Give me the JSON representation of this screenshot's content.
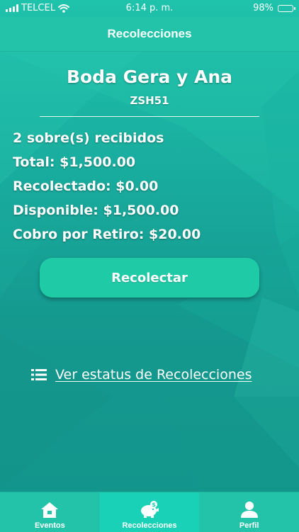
{
  "status_bar": {
    "carrier": "TELCEL",
    "time": "6:14 p. m.",
    "battery": "98%"
  },
  "nav": {
    "title": "Recolecciones"
  },
  "event": {
    "name": "Boda Gera y Ana",
    "code": "ZSH51"
  },
  "summary": {
    "envelopes": "2 sobre(s) recibidos",
    "total": "Total: $1,500.00",
    "collected": "Recolectado: $0.00",
    "available": "Disponible: $1,500.00",
    "fee": "Cobro por Retiro: $20.00"
  },
  "actions": {
    "collect_label": "Recolectar",
    "status_link": "Ver estatus de Recolecciones"
  },
  "tabs": [
    {
      "label": "Eventos",
      "icon": "home-icon"
    },
    {
      "label": "Recolecciones",
      "icon": "piggy-bank-icon"
    },
    {
      "label": "Perfil",
      "icon": "user-icon"
    }
  ],
  "colors": {
    "primary": "#22c3a9",
    "active_tab": "#18d1b6",
    "button": "#1fcba7"
  }
}
